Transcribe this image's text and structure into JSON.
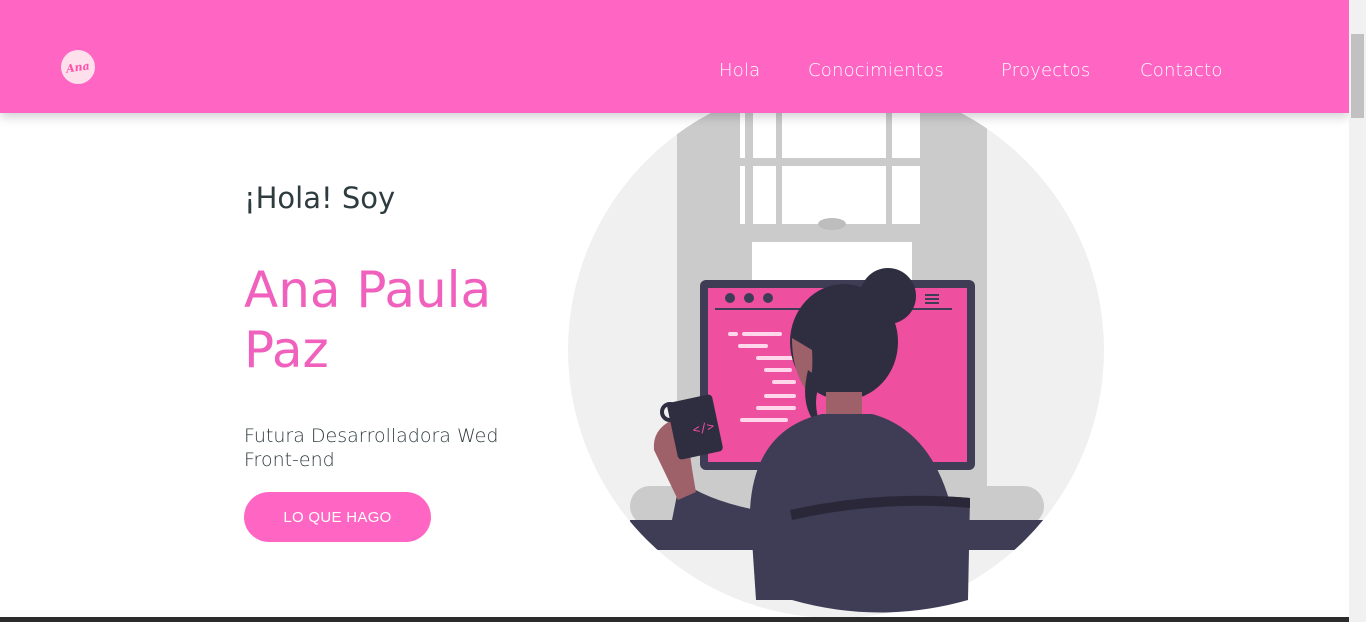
{
  "header": {
    "logo_text": "Ana",
    "nav": [
      {
        "label": "Hola"
      },
      {
        "label": "Conocimientos"
      },
      {
        "label": "Proyectos"
      },
      {
        "label": "Contacto"
      }
    ]
  },
  "hero": {
    "greeting": "¡Hola! Soy",
    "name": "Ana Paula Paz",
    "subtitle": "Futura Desarrolladora Wed Front-end",
    "cta_label": "LO QUE HAGO"
  },
  "illustration": {
    "mug_text": "</>"
  },
  "colors": {
    "brand_pink": "#ff66c4",
    "name_pink": "#f061bd",
    "text_dark": "#2e3c40"
  }
}
